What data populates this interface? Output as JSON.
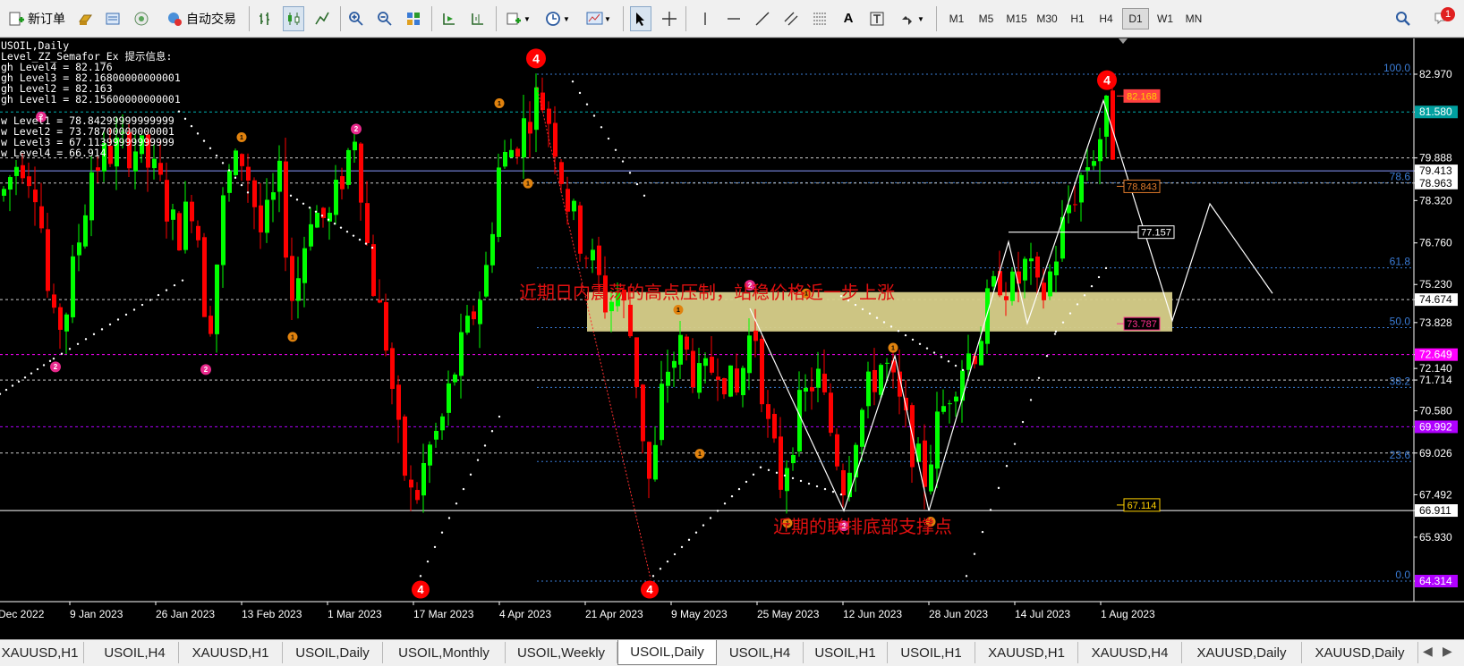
{
  "toolbar": {
    "new_order_label": "新订单",
    "auto_trade_label": "自动交易",
    "timeframes": [
      "M1",
      "M5",
      "M15",
      "M30",
      "H1",
      "H4",
      "D1",
      "W1",
      "MN"
    ],
    "active_timeframe": "D1",
    "notification_count": "1"
  },
  "chart": {
    "symbol_title": "USOIL,Daily",
    "indicator_lines": [
      "Level_ZZ_Semafor_Ex 提示信息:",
      "gh Level4 = 82.176",
      "gh Level3 = 82.16800000000001",
      "gh Level2 = 82.163",
      "gh Level1 = 82.15600000000001",
      "",
      "w Level1 = 78.84299999999999",
      "w Level2 = 73.78700000000001",
      "w Level3 = 67.11399999999999",
      "w Level4 = 66.914"
    ],
    "annotation_top": "近期日内震荡的高点压制，站稳价格近一步上涨",
    "annotation_bottom": "近期的联排底部支撑点",
    "price_axis": [
      "82.970",
      "81.580",
      "79.888",
      "79.413",
      "78.963",
      "78.320",
      "76.760",
      "75.230",
      "74.674",
      "73.828",
      "72.649",
      "72.140",
      "71.714",
      "70.580",
      "69.992",
      "69.026",
      "67.492",
      "66.911",
      "65.930",
      "64.314"
    ],
    "price_axis_highlight": [
      {
        "label": "81.580",
        "color": "#00a0a0"
      },
      {
        "label": "72.649",
        "color": "#ff00ff"
      },
      {
        "label": "69.992",
        "color": "#b000ff"
      },
      {
        "label": "64.314",
        "color": "#b000ff"
      }
    ],
    "fib_labels": [
      "100.0",
      "78.6",
      "61.8",
      "50.0",
      "38.2",
      "23.6",
      "0.0"
    ],
    "level_boxes": [
      "82.168",
      "78.843",
      "77.157",
      "73.787",
      "67.114"
    ],
    "date_axis": [
      "Dec 2022",
      "9 Jan 2023",
      "26 Jan 2023",
      "13 Feb 2023",
      "1 Mar 2023",
      "17 Mar 2023",
      "4 Apr 2023",
      "21 Apr 2023",
      "9 May 2023",
      "25 May 2023",
      "12 Jun 2023",
      "28 Jun 2023",
      "14 Jul 2023",
      "1 Aug 2023"
    ],
    "semafor_markers": [
      "4",
      "4",
      "4",
      "4",
      "2",
      "2",
      "2",
      "2",
      "2",
      "2",
      "1",
      "1",
      "1",
      "1",
      "1",
      "1",
      "1",
      "1",
      "1",
      "1"
    ],
    "colors": {
      "bull": "#00ff00",
      "bear": "#ff0000",
      "zone": "#d8d08a",
      "fib": "#3a7bd5",
      "text_red": "#e01010"
    }
  },
  "tabs": [
    "XAUUSD,H1",
    "USOIL,H4",
    "XAUUSD,H1",
    "USOIL,Daily",
    "USOIL,Monthly",
    "USOIL,Weekly",
    "USOIL,Daily",
    "USOIL,H4",
    "USOIL,H1",
    "USOIL,H1",
    "XAUUSD,H1",
    "XAUUSD,H4",
    "XAUUSD,Daily",
    "XAUUSD,Daily"
  ],
  "active_tab_index": 6
}
